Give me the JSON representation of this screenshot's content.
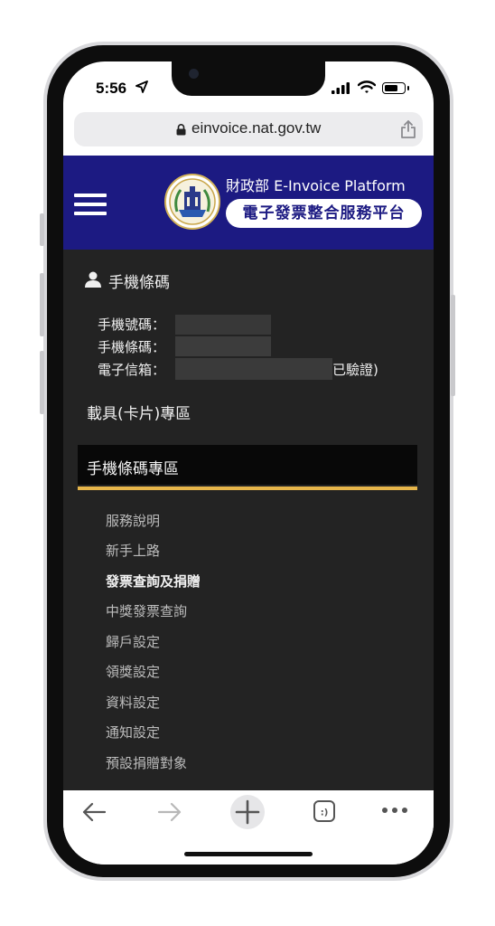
{
  "status_bar": {
    "time": "5:56",
    "icons": [
      "location-arrow-icon",
      "signal-bars-icon",
      "wifi-icon",
      "battery-icon"
    ]
  },
  "browser": {
    "url": "einvoice.nat.gov.tw",
    "lock_icon": "lock-icon",
    "share_icon": "share-icon"
  },
  "header": {
    "title_en": "財政部 E-Invoice Platform",
    "subtitle": "電子發票整合服務平台",
    "menu_icon": "hamburger-menu-icon",
    "logo": "ministry-seal-logo",
    "color": "#1c1a82"
  },
  "account": {
    "title": "手機條碼",
    "fields": [
      {
        "label": "手機號碼："
      },
      {
        "label": "手機條碼："
      },
      {
        "label": "電子信箱："
      }
    ],
    "email_status": "已驗證)"
  },
  "carrier_link": "載具(卡片)專區",
  "section": {
    "title": "手機條碼專區",
    "accent": "#e6b54a",
    "items": [
      {
        "label": "服務說明",
        "active": false
      },
      {
        "label": "新手上路",
        "active": false
      },
      {
        "label": "發票查詢及捐贈",
        "active": true
      },
      {
        "label": "中獎發票查詢",
        "active": false
      },
      {
        "label": "歸戶設定",
        "active": false
      },
      {
        "label": "領獎設定",
        "active": false
      },
      {
        "label": "資料設定",
        "active": false
      },
      {
        "label": "通知設定",
        "active": false
      },
      {
        "label": "預設捐贈對象",
        "active": false
      }
    ]
  },
  "toolbar": {
    "buttons": [
      "back-icon",
      "forward-icon",
      "new-tab-icon",
      "tabs-icon",
      "more-icon"
    ]
  }
}
